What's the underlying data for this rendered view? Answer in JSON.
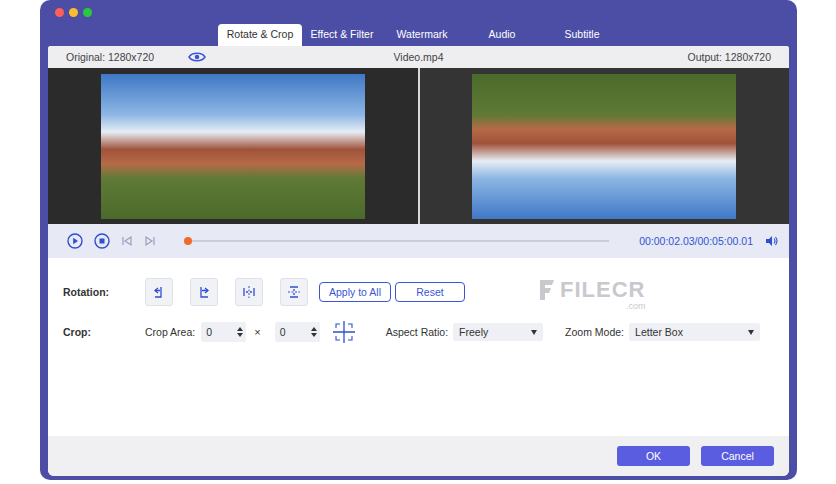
{
  "window": {
    "traffic_lights": [
      {
        "color": "#ff5f57"
      },
      {
        "color": "#febc2e"
      },
      {
        "color": "#28c840"
      }
    ]
  },
  "tabs": [
    {
      "label": "Rotate & Crop",
      "selected": true
    },
    {
      "label": "Effect & Filter",
      "selected": false
    },
    {
      "label": "Watermark",
      "selected": false
    },
    {
      "label": "Audio",
      "selected": false
    },
    {
      "label": "Subtitle",
      "selected": false
    }
  ],
  "info_bar": {
    "original": "Original: 1280x720",
    "file": "Video.mp4",
    "output": "Output: 1280x720"
  },
  "player": {
    "time": "00:00:02.03/00:05:00.01",
    "level": 0.007
  },
  "rotation": {
    "label": "Rotation:",
    "buttons": [
      "Apply to All",
      "Reset"
    ]
  },
  "crop": {
    "label": "Crop:",
    "area_label": "Crop Area:",
    "width": "0",
    "times": "×",
    "height": "0",
    "aspect_label": "Aspect Ratio:",
    "aspect": "Freely",
    "zoom_label": "Zoom Mode:",
    "zoom": "Letter Box"
  },
  "watermark": {
    "text": "FILECR",
    "sub": ".com"
  },
  "buttons": [
    {
      "label": "OK"
    },
    {
      "label": "Cancel"
    }
  ]
}
